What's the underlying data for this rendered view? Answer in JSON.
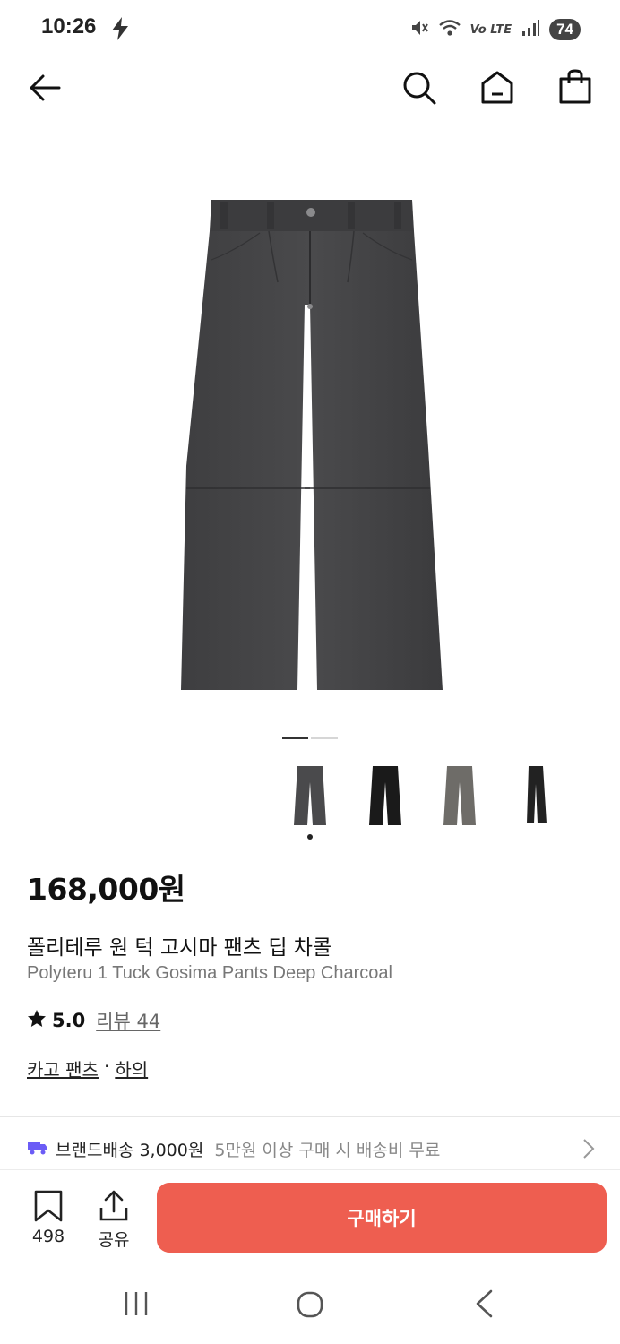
{
  "status_bar": {
    "time": "10:26",
    "battery": "74",
    "network": "Vo LTE"
  },
  "top_bar": {
    "icons": [
      "back-arrow-icon",
      "search-icon",
      "home-icon",
      "shopping-bag-icon"
    ]
  },
  "gallery": {
    "page_index": 1,
    "page_count": 2
  },
  "color_options": [
    {
      "name": "deep-charcoal",
      "color": "#4a4a4c",
      "selected": true
    },
    {
      "name": "black",
      "color": "#1a1a1a",
      "selected": false
    },
    {
      "name": "grey",
      "color": "#6e6c68",
      "selected": false
    },
    {
      "name": "black-2",
      "color": "#222222",
      "selected": false
    }
  ],
  "product": {
    "price": "168,000원",
    "name_ko": "폴리테루 원 턱 고시마 팬츠 딥 차콜",
    "name_en": "Polyteru 1 Tuck Gosima Pants Deep Charcoal",
    "rating": "5.0",
    "review_label": "리뷰 44",
    "category_1": "카고 팬츠",
    "category_sep": "·",
    "category_2": "하의"
  },
  "shipping": {
    "label": "브랜드배송 3,000원",
    "note": "5만원 이상 구매 시 배송비 무료"
  },
  "bottom_bar": {
    "bookmark_count": "498",
    "share_label": "공유",
    "buy_label": "구매하기"
  },
  "colors": {
    "accent": "#ee5e50",
    "ship_icon": "#6b5cf6",
    "text": "#111111",
    "muted": "#777777"
  }
}
